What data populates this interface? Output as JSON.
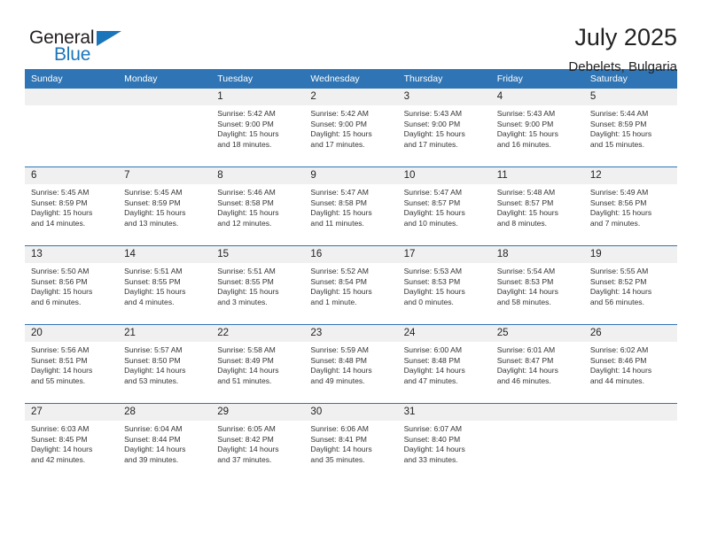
{
  "logo": {
    "word_one": "General",
    "word_two": "Blue",
    "triangle": "triangle-icon",
    "brand_blue": "#1b75bb"
  },
  "header": {
    "title": "July 2025",
    "subtitle": "Debelets, Bulgaria",
    "accent_color": "#2f75b5"
  },
  "calendar": {
    "weekday_headers": [
      "Sunday",
      "Monday",
      "Tuesday",
      "Wednesday",
      "Thursday",
      "Friday",
      "Saturday"
    ],
    "weeks": [
      [
        {
          "day": "",
          "empty": true
        },
        {
          "day": "",
          "empty": true
        },
        {
          "day": "1",
          "sunrise": "Sunrise: 5:42 AM",
          "sunset": "Sunset: 9:00 PM",
          "daylight_1": "Daylight: 15 hours",
          "daylight_2": "and 18 minutes."
        },
        {
          "day": "2",
          "sunrise": "Sunrise: 5:42 AM",
          "sunset": "Sunset: 9:00 PM",
          "daylight_1": "Daylight: 15 hours",
          "daylight_2": "and 17 minutes."
        },
        {
          "day": "3",
          "sunrise": "Sunrise: 5:43 AM",
          "sunset": "Sunset: 9:00 PM",
          "daylight_1": "Daylight: 15 hours",
          "daylight_2": "and 17 minutes."
        },
        {
          "day": "4",
          "sunrise": "Sunrise: 5:43 AM",
          "sunset": "Sunset: 9:00 PM",
          "daylight_1": "Daylight: 15 hours",
          "daylight_2": "and 16 minutes."
        },
        {
          "day": "5",
          "sunrise": "Sunrise: 5:44 AM",
          "sunset": "Sunset: 8:59 PM",
          "daylight_1": "Daylight: 15 hours",
          "daylight_2": "and 15 minutes."
        }
      ],
      [
        {
          "day": "6",
          "sunrise": "Sunrise: 5:45 AM",
          "sunset": "Sunset: 8:59 PM",
          "daylight_1": "Daylight: 15 hours",
          "daylight_2": "and 14 minutes."
        },
        {
          "day": "7",
          "sunrise": "Sunrise: 5:45 AM",
          "sunset": "Sunset: 8:59 PM",
          "daylight_1": "Daylight: 15 hours",
          "daylight_2": "and 13 minutes."
        },
        {
          "day": "8",
          "sunrise": "Sunrise: 5:46 AM",
          "sunset": "Sunset: 8:58 PM",
          "daylight_1": "Daylight: 15 hours",
          "daylight_2": "and 12 minutes."
        },
        {
          "day": "9",
          "sunrise": "Sunrise: 5:47 AM",
          "sunset": "Sunset: 8:58 PM",
          "daylight_1": "Daylight: 15 hours",
          "daylight_2": "and 11 minutes."
        },
        {
          "day": "10",
          "sunrise": "Sunrise: 5:47 AM",
          "sunset": "Sunset: 8:57 PM",
          "daylight_1": "Daylight: 15 hours",
          "daylight_2": "and 10 minutes."
        },
        {
          "day": "11",
          "sunrise": "Sunrise: 5:48 AM",
          "sunset": "Sunset: 8:57 PM",
          "daylight_1": "Daylight: 15 hours",
          "daylight_2": "and 8 minutes."
        },
        {
          "day": "12",
          "sunrise": "Sunrise: 5:49 AM",
          "sunset": "Sunset: 8:56 PM",
          "daylight_1": "Daylight: 15 hours",
          "daylight_2": "and 7 minutes."
        }
      ],
      [
        {
          "day": "13",
          "sunrise": "Sunrise: 5:50 AM",
          "sunset": "Sunset: 8:56 PM",
          "daylight_1": "Daylight: 15 hours",
          "daylight_2": "and 6 minutes."
        },
        {
          "day": "14",
          "sunrise": "Sunrise: 5:51 AM",
          "sunset": "Sunset: 8:55 PM",
          "daylight_1": "Daylight: 15 hours",
          "daylight_2": "and 4 minutes."
        },
        {
          "day": "15",
          "sunrise": "Sunrise: 5:51 AM",
          "sunset": "Sunset: 8:55 PM",
          "daylight_1": "Daylight: 15 hours",
          "daylight_2": "and 3 minutes."
        },
        {
          "day": "16",
          "sunrise": "Sunrise: 5:52 AM",
          "sunset": "Sunset: 8:54 PM",
          "daylight_1": "Daylight: 15 hours",
          "daylight_2": "and 1 minute."
        },
        {
          "day": "17",
          "sunrise": "Sunrise: 5:53 AM",
          "sunset": "Sunset: 8:53 PM",
          "daylight_1": "Daylight: 15 hours",
          "daylight_2": "and 0 minutes."
        },
        {
          "day": "18",
          "sunrise": "Sunrise: 5:54 AM",
          "sunset": "Sunset: 8:53 PM",
          "daylight_1": "Daylight: 14 hours",
          "daylight_2": "and 58 minutes."
        },
        {
          "day": "19",
          "sunrise": "Sunrise: 5:55 AM",
          "sunset": "Sunset: 8:52 PM",
          "daylight_1": "Daylight: 14 hours",
          "daylight_2": "and 56 minutes."
        }
      ],
      [
        {
          "day": "20",
          "sunrise": "Sunrise: 5:56 AM",
          "sunset": "Sunset: 8:51 PM",
          "daylight_1": "Daylight: 14 hours",
          "daylight_2": "and 55 minutes."
        },
        {
          "day": "21",
          "sunrise": "Sunrise: 5:57 AM",
          "sunset": "Sunset: 8:50 PM",
          "daylight_1": "Daylight: 14 hours",
          "daylight_2": "and 53 minutes."
        },
        {
          "day": "22",
          "sunrise": "Sunrise: 5:58 AM",
          "sunset": "Sunset: 8:49 PM",
          "daylight_1": "Daylight: 14 hours",
          "daylight_2": "and 51 minutes."
        },
        {
          "day": "23",
          "sunrise": "Sunrise: 5:59 AM",
          "sunset": "Sunset: 8:48 PM",
          "daylight_1": "Daylight: 14 hours",
          "daylight_2": "and 49 minutes."
        },
        {
          "day": "24",
          "sunrise": "Sunrise: 6:00 AM",
          "sunset": "Sunset: 8:48 PM",
          "daylight_1": "Daylight: 14 hours",
          "daylight_2": "and 47 minutes."
        },
        {
          "day": "25",
          "sunrise": "Sunrise: 6:01 AM",
          "sunset": "Sunset: 8:47 PM",
          "daylight_1": "Daylight: 14 hours",
          "daylight_2": "and 46 minutes."
        },
        {
          "day": "26",
          "sunrise": "Sunrise: 6:02 AM",
          "sunset": "Sunset: 8:46 PM",
          "daylight_1": "Daylight: 14 hours",
          "daylight_2": "and 44 minutes."
        }
      ],
      [
        {
          "day": "27",
          "sunrise": "Sunrise: 6:03 AM",
          "sunset": "Sunset: 8:45 PM",
          "daylight_1": "Daylight: 14 hours",
          "daylight_2": "and 42 minutes."
        },
        {
          "day": "28",
          "sunrise": "Sunrise: 6:04 AM",
          "sunset": "Sunset: 8:44 PM",
          "daylight_1": "Daylight: 14 hours",
          "daylight_2": "and 39 minutes."
        },
        {
          "day": "29",
          "sunrise": "Sunrise: 6:05 AM",
          "sunset": "Sunset: 8:42 PM",
          "daylight_1": "Daylight: 14 hours",
          "daylight_2": "and 37 minutes."
        },
        {
          "day": "30",
          "sunrise": "Sunrise: 6:06 AM",
          "sunset": "Sunset: 8:41 PM",
          "daylight_1": "Daylight: 14 hours",
          "daylight_2": "and 35 minutes."
        },
        {
          "day": "31",
          "sunrise": "Sunrise: 6:07 AM",
          "sunset": "Sunset: 8:40 PM",
          "daylight_1": "Daylight: 14 hours",
          "daylight_2": "and 33 minutes."
        },
        {
          "day": "",
          "empty": true
        },
        {
          "day": "",
          "empty": true
        }
      ]
    ]
  }
}
